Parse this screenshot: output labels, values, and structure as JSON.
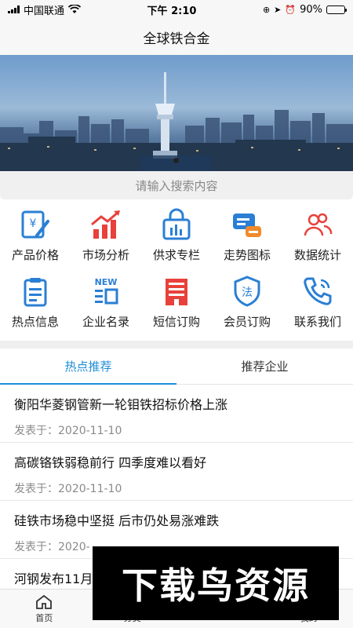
{
  "status_bar": {
    "carrier": "中国联通",
    "time": "下午 2:10",
    "battery_percent": "90%",
    "battery_level": 0.9
  },
  "nav": {
    "title": "全球铁合金"
  },
  "search": {
    "placeholder": "请输入搜索内容"
  },
  "grid": [
    {
      "label": "产品价格",
      "icon": "price-tag-icon"
    },
    {
      "label": "市场分析",
      "icon": "chart-up-icon"
    },
    {
      "label": "供求专栏",
      "icon": "shopping-bag-icon"
    },
    {
      "label": "走势图标",
      "icon": "trend-chat-icon"
    },
    {
      "label": "数据统计",
      "icon": "users-icon"
    },
    {
      "label": "热点信息",
      "icon": "clipboard-icon"
    },
    {
      "label": "企业名录",
      "icon": "new-list-icon"
    },
    {
      "label": "短信订购",
      "icon": "building-icon"
    },
    {
      "label": "会员订购",
      "icon": "shield-law-icon"
    },
    {
      "label": "联系我们",
      "icon": "phone-icon"
    }
  ],
  "grid_icon_text": {
    "new_badge": "NEW",
    "law_char": "法",
    "yen": "¥"
  },
  "tabs": [
    {
      "label": "热点推荐",
      "active": true
    },
    {
      "label": "推荐企业",
      "active": false
    }
  ],
  "news": [
    {
      "title": "衡阳华菱钢管新一轮钼铁招标价格上涨",
      "date": "发表于：2020-11-10"
    },
    {
      "title": "高碳铬铁弱稳前行 四季度难以看好",
      "date": "发表于：2020-11-10"
    },
    {
      "title": "硅铁市场稳中坚挺 后市仍处易涨难跌",
      "date": "发表于：2020-"
    },
    {
      "title": "河钢发布11月",
      "date": ""
    }
  ],
  "tabbar": [
    {
      "label": "首页",
      "icon": "home-icon"
    },
    {
      "label": "分类",
      "icon": "category-icon"
    },
    {
      "label": "",
      "icon": "blank"
    },
    {
      "label": "我的",
      "icon": "user-icon"
    }
  ],
  "watermark": {
    "text": "下载鸟资源"
  },
  "colors": {
    "accent": "#1f8ed8",
    "red": "#e8413b",
    "blue": "#2a7fd4"
  }
}
